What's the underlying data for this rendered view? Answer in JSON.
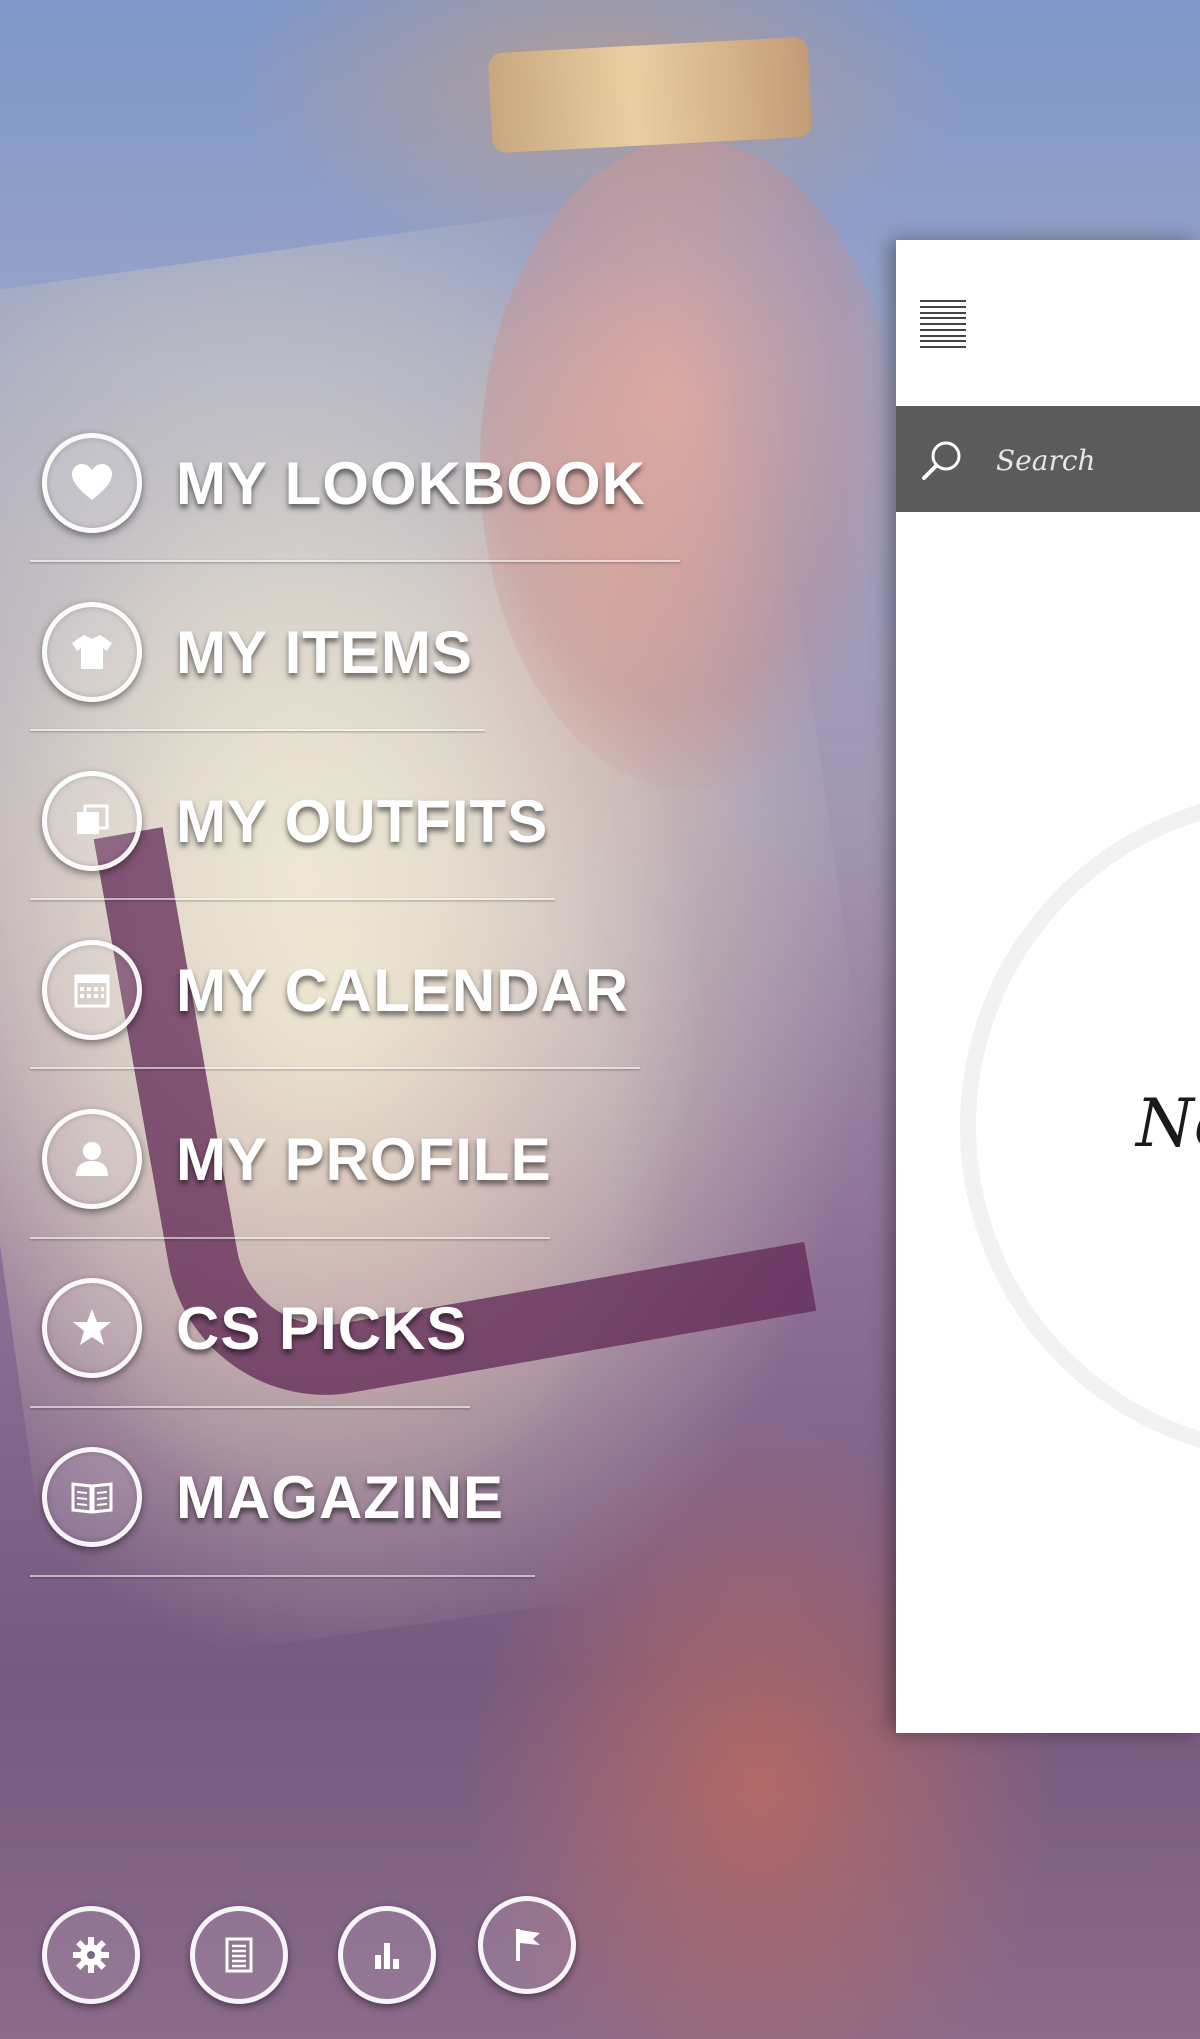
{
  "menu": {
    "items": [
      {
        "label": "MY LOOKBOOK",
        "icon": "heart-icon"
      },
      {
        "label": "MY ITEMS",
        "icon": "tshirt-icon"
      },
      {
        "label": "MY OUTFITS",
        "icon": "layers-icon"
      },
      {
        "label": "MY CALENDAR",
        "icon": "calendar-icon"
      },
      {
        "label": "MY PROFILE",
        "icon": "user-icon"
      },
      {
        "label": "CS PICKS",
        "icon": "star-icon"
      },
      {
        "label": "MAGAZINE",
        "icon": "book-icon"
      }
    ]
  },
  "bottom_bar": {
    "icons": [
      "settings-gear-icon",
      "document-list-icon",
      "bar-chart-icon",
      "flag-icon"
    ]
  },
  "panel": {
    "search_placeholder": "Search",
    "empty_text_partial": "No"
  }
}
